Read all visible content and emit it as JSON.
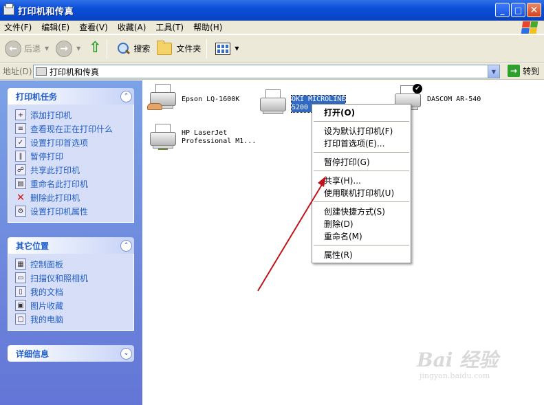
{
  "window": {
    "title": "打印机和传真"
  },
  "menubar": {
    "items": [
      "文件(F)",
      "编辑(E)",
      "查看(V)",
      "收藏(A)",
      "工具(T)",
      "帮助(H)"
    ]
  },
  "toolbar": {
    "back_label": "后退",
    "search_label": "搜索",
    "folders_label": "文件夹"
  },
  "address": {
    "label": "地址(D)",
    "value": "打印机和传真",
    "go_label": "转到"
  },
  "sidebar": {
    "printer_tasks": {
      "title": "打印机任务",
      "items": [
        {
          "label": "添加打印机",
          "icon": "add-printer-icon"
        },
        {
          "label": "查看现在正在打印什么",
          "icon": "print-queue-icon"
        },
        {
          "label": "设置打印首选项",
          "icon": "preferences-icon"
        },
        {
          "label": "暂停打印",
          "icon": "pause-icon"
        },
        {
          "label": "共享此打印机",
          "icon": "share-icon"
        },
        {
          "label": "重命名此打印机",
          "icon": "rename-icon"
        },
        {
          "label": "删除此打印机",
          "icon": "delete-icon"
        },
        {
          "label": "设置打印机属性",
          "icon": "properties-icon"
        }
      ]
    },
    "other_places": {
      "title": "其它位置",
      "items": [
        {
          "label": "控制面板",
          "icon": "control-panel-icon"
        },
        {
          "label": "扫描仪和照相机",
          "icon": "scanner-icon"
        },
        {
          "label": "我的文档",
          "icon": "documents-icon"
        },
        {
          "label": "图片收藏",
          "icon": "pictures-icon"
        },
        {
          "label": "我的电脑",
          "icon": "computer-icon"
        }
      ]
    },
    "details": {
      "title": "详细信息"
    }
  },
  "printers": [
    {
      "name": "Epson LQ-1600K",
      "icon": "shared-printer-icon"
    },
    {
      "name": "OKI MICROLINE\n5200",
      "icon": "printer-icon",
      "selected": true
    },
    {
      "name": "DASCOM AR-540",
      "icon": "default-printer-icon"
    },
    {
      "name": "HP LaserJet\nProfessional M1...",
      "icon": "network-printer-icon"
    }
  ],
  "context_menu": {
    "open": "打开(O)",
    "set_default": "设为默认打印机(F)",
    "preferences": "打印首选项(E)...",
    "pause": "暂停打印(G)",
    "share": "共享(H)...",
    "use_online": "使用联机打印机(U)",
    "shortcut": "创建快捷方式(S)",
    "delete": "删除(D)",
    "rename": "重命名(M)",
    "properties": "属性(R)"
  },
  "watermark": {
    "main": "Bai 经验",
    "sub": "jingyan.baidu.com"
  },
  "colors": {
    "title_bar": "#0b4fd8",
    "sidebar_bg": "#6f8ade",
    "selection": "#316ac5",
    "annotation_arrow": "#c0141c"
  }
}
